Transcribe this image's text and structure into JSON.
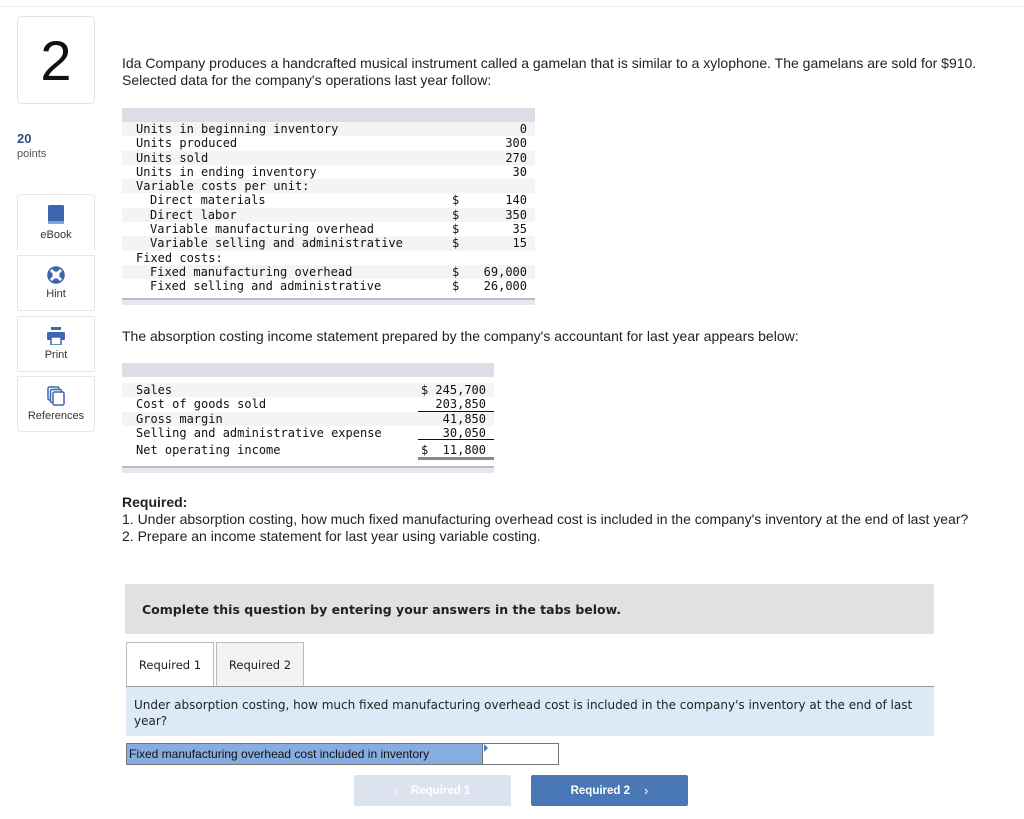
{
  "question": {
    "number": "2",
    "points_value": "20",
    "points_label": "points"
  },
  "tools": [
    {
      "label": "eBook",
      "icon": "book-icon"
    },
    {
      "label": "Hint",
      "icon": "lifebuoy-icon"
    },
    {
      "label": "Print",
      "icon": "printer-icon"
    },
    {
      "label": "References",
      "icon": "documents-icon"
    }
  ],
  "intro": "Ida Company produces a handcrafted musical instrument called a gamelan that is similar to a xylophone. The gamelans are sold for $910. Selected data for the company's operations last year follow:",
  "data_table": {
    "rows": [
      {
        "label": "Units in beginning inventory",
        "indent": false,
        "currency": "",
        "value": "0"
      },
      {
        "label": "Units produced",
        "indent": false,
        "currency": "",
        "value": "300"
      },
      {
        "label": "Units sold",
        "indent": false,
        "currency": "",
        "value": "270"
      },
      {
        "label": "Units in ending inventory",
        "indent": false,
        "currency": "",
        "value": "30"
      },
      {
        "label": "Variable costs per unit:",
        "indent": false,
        "currency": "",
        "value": ""
      },
      {
        "label": "Direct materials",
        "indent": true,
        "currency": "$",
        "value": "140"
      },
      {
        "label": "Direct labor",
        "indent": true,
        "currency": "$",
        "value": "350"
      },
      {
        "label": "Variable manufacturing overhead",
        "indent": true,
        "currency": "$",
        "value": "35"
      },
      {
        "label": "Variable selling and administrative",
        "indent": true,
        "currency": "$",
        "value": "15"
      },
      {
        "label": "Fixed costs:",
        "indent": false,
        "currency": "",
        "value": ""
      },
      {
        "label": "Fixed manufacturing overhead",
        "indent": true,
        "currency": "$",
        "value": "69,000"
      },
      {
        "label": "Fixed selling and administrative",
        "indent": true,
        "currency": "$",
        "value": "26,000"
      }
    ]
  },
  "statement_intro": "The absorption costing income statement prepared by the company's accountant for last year appears below:",
  "income_statement": {
    "rows": [
      {
        "label": "Sales",
        "value": "$ 245,700"
      },
      {
        "label": "Cost of goods sold",
        "value": "203,850"
      },
      {
        "label": "Gross margin",
        "value": "41,850"
      },
      {
        "label": "Selling and administrative expense",
        "value": "30,050"
      },
      {
        "label": "Net operating income",
        "value": "$  11,800"
      }
    ]
  },
  "required": {
    "heading": "Required:",
    "item1": "1. Under absorption costing, how much fixed manufacturing overhead cost is included in the company's inventory at the end of last year?",
    "item2": "2. Prepare an income statement for last year using variable costing."
  },
  "banner": "Complete this question by entering your answers in the tabs below.",
  "tabs": [
    {
      "label": "Required 1",
      "active": true
    },
    {
      "label": "Required 2",
      "active": false
    }
  ],
  "tab_question": "Under absorption costing, how much fixed manufacturing overhead cost is included in the company's inventory at the end of last year?",
  "answer": {
    "label": "Fixed manufacturing overhead cost included in inventory",
    "value": ""
  },
  "nav": {
    "prev_label": "Required 1",
    "next_label": "Required 2",
    "prev_icon": "chevron-left-icon",
    "next_icon": "chevron-right-icon"
  },
  "colors": {
    "accent": "#4a78b6",
    "points": "#2b4f86",
    "answer_label_bg": "#87ace0",
    "question_box_bg": "#dceaf7"
  }
}
